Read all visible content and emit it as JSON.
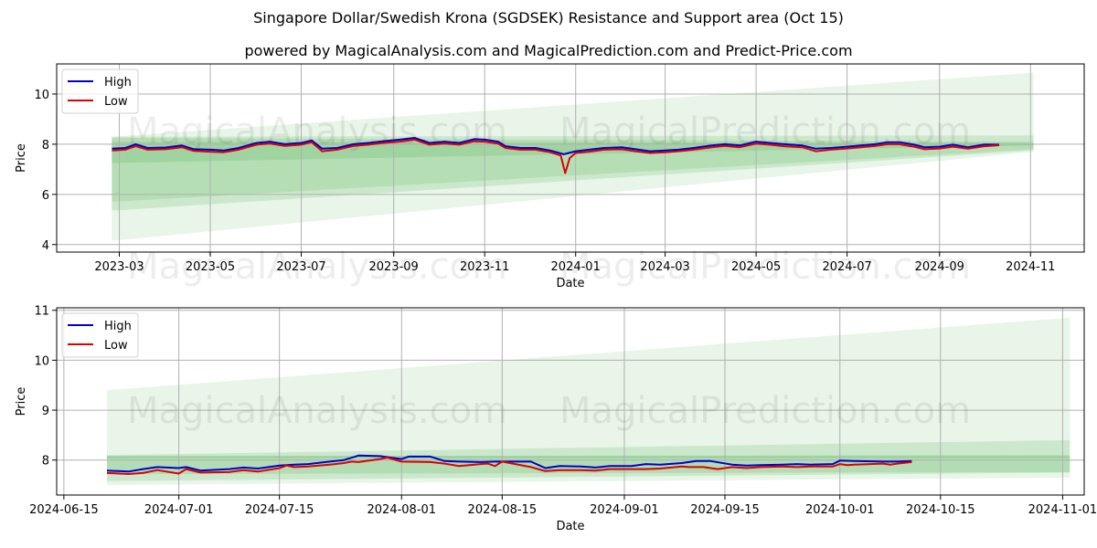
{
  "header": {
    "title": "Singapore Dollar/Swedish Krona (SGDSEK) Resistance and Support area (Oct 15)",
    "subtitle": "powered by MagicalAnalysis.com and MagicalPrediction.com and Predict-Price.com"
  },
  "watermarks": [
    "MagicalAnalysis.com",
    "MagicalPrediction.com"
  ],
  "colors": {
    "high": "#0000cc",
    "low": "#dd0000",
    "band": "#4caf50",
    "grid": "#b0b0b0"
  },
  "chart_data": [
    {
      "type": "line",
      "title": "",
      "xlabel": "Date",
      "ylabel": "Price",
      "grid": true,
      "legend": "top-left",
      "xlim": [
        "2023-01-18",
        "2024-12-07"
      ],
      "ylim": [
        3.7,
        11.2
      ],
      "x_ticks": [
        "2023-03",
        "2023-05",
        "2023-07",
        "2023-09",
        "2023-11",
        "2024-01",
        "2024-03",
        "2024-05",
        "2024-07",
        "2024-09",
        "2024-11"
      ],
      "x_tick_dates": [
        "2023-03-01",
        "2023-05-01",
        "2023-07-01",
        "2023-09-01",
        "2023-11-01",
        "2024-01-01",
        "2024-03-01",
        "2024-05-01",
        "2024-07-01",
        "2024-09-01",
        "2024-11-01"
      ],
      "y_ticks": [
        4,
        6,
        8,
        10
      ],
      "bands": [
        {
          "name": "wide-band",
          "x": [
            "2023-02-24",
            "2024-11-03"
          ],
          "upper": [
            8.3,
            10.85
          ],
          "lower": [
            4.15,
            7.7
          ],
          "opacity": 0.13
        },
        {
          "name": "mid-band",
          "x": [
            "2023-02-24",
            "2024-11-03"
          ],
          "upper": [
            8.3,
            8.35
          ],
          "lower": [
            5.35,
            7.75
          ],
          "opacity": 0.18
        },
        {
          "name": "inner-band",
          "x": [
            "2023-02-24",
            "2024-11-03"
          ],
          "upper": [
            8.25,
            8.1
          ],
          "lower": [
            5.7,
            7.8
          ],
          "opacity": 0.18
        },
        {
          "name": "core-band",
          "x": [
            "2023-02-24",
            "2024-11-03"
          ],
          "upper": [
            8.1,
            8.05
          ],
          "lower": [
            7.25,
            7.95
          ],
          "opacity": 0.2
        }
      ],
      "series": [
        {
          "name": "High",
          "x": [
            "2023-02-24",
            "2023-03-05",
            "2023-03-12",
            "2023-03-20",
            "2023-04-01",
            "2023-04-12",
            "2023-04-20",
            "2023-05-01",
            "2023-05-10",
            "2023-05-20",
            "2023-06-01",
            "2023-06-10",
            "2023-06-20",
            "2023-07-01",
            "2023-07-08",
            "2023-07-15",
            "2023-07-25",
            "2023-08-05",
            "2023-08-15",
            "2023-08-25",
            "2023-09-05",
            "2023-09-15",
            "2023-09-25",
            "2023-10-05",
            "2023-10-15",
            "2023-10-25",
            "2023-11-01",
            "2023-11-10",
            "2023-11-15",
            "2023-11-25",
            "2023-12-05",
            "2023-12-15",
            "2023-12-24",
            "2024-01-01",
            "2024-01-10",
            "2024-01-20",
            "2024-02-01",
            "2024-02-10",
            "2024-02-20",
            "2024-03-01",
            "2024-03-10",
            "2024-03-20",
            "2024-04-01",
            "2024-04-10",
            "2024-04-20",
            "2024-05-01",
            "2024-05-10",
            "2024-05-20",
            "2024-06-01",
            "2024-06-10",
            "2024-06-20",
            "2024-07-01",
            "2024-07-10",
            "2024-07-20",
            "2024-07-28",
            "2024-08-05",
            "2024-08-15",
            "2024-08-22",
            "2024-09-01",
            "2024-09-10",
            "2024-09-20",
            "2024-10-01",
            "2024-10-11"
          ],
          "values": [
            7.82,
            7.85,
            8.0,
            7.85,
            7.87,
            7.95,
            7.8,
            7.78,
            7.75,
            7.85,
            8.05,
            8.1,
            8.0,
            8.05,
            8.15,
            7.82,
            7.85,
            8.0,
            8.05,
            8.12,
            8.18,
            8.25,
            8.05,
            8.1,
            8.05,
            8.2,
            8.18,
            8.1,
            7.92,
            7.85,
            7.85,
            7.75,
            7.6,
            7.72,
            7.78,
            7.85,
            7.88,
            7.8,
            7.72,
            7.75,
            7.78,
            7.85,
            7.95,
            8.0,
            7.95,
            8.1,
            8.05,
            8.0,
            7.95,
            7.82,
            7.85,
            7.9,
            7.95,
            8.0,
            8.08,
            8.08,
            7.98,
            7.88,
            7.9,
            7.98,
            7.88,
            7.99,
            7.98
          ],
          "color": "#0000cc"
        },
        {
          "name": "Low",
          "x": [
            "2023-02-24",
            "2023-03-05",
            "2023-03-12",
            "2023-03-20",
            "2023-04-01",
            "2023-04-12",
            "2023-04-20",
            "2023-05-01",
            "2023-05-10",
            "2023-05-20",
            "2023-06-01",
            "2023-06-10",
            "2023-06-20",
            "2023-07-01",
            "2023-07-08",
            "2023-07-15",
            "2023-07-25",
            "2023-08-05",
            "2023-08-15",
            "2023-08-25",
            "2023-09-05",
            "2023-09-15",
            "2023-09-25",
            "2023-10-05",
            "2023-10-15",
            "2023-10-25",
            "2023-11-01",
            "2023-11-10",
            "2023-11-15",
            "2023-11-25",
            "2023-12-05",
            "2023-12-15",
            "2023-12-22",
            "2023-12-25",
            "2023-12-28",
            "2024-01-01",
            "2024-01-10",
            "2024-01-20",
            "2024-02-01",
            "2024-02-10",
            "2024-02-20",
            "2024-03-01",
            "2024-03-10",
            "2024-03-20",
            "2024-04-01",
            "2024-04-10",
            "2024-04-20",
            "2024-05-01",
            "2024-05-10",
            "2024-05-20",
            "2024-06-01",
            "2024-06-10",
            "2024-06-20",
            "2024-07-01",
            "2024-07-10",
            "2024-07-20",
            "2024-07-28",
            "2024-08-05",
            "2024-08-15",
            "2024-08-22",
            "2024-09-01",
            "2024-09-10",
            "2024-09-20",
            "2024-10-01",
            "2024-10-11"
          ],
          "values": [
            7.75,
            7.78,
            7.92,
            7.78,
            7.8,
            7.88,
            7.73,
            7.7,
            7.68,
            7.78,
            7.98,
            8.03,
            7.93,
            7.98,
            8.08,
            7.72,
            7.78,
            7.93,
            7.98,
            8.05,
            8.1,
            8.18,
            7.98,
            8.03,
            7.98,
            8.12,
            8.1,
            8.02,
            7.85,
            7.78,
            7.78,
            7.68,
            7.55,
            6.85,
            7.45,
            7.65,
            7.7,
            7.78,
            7.8,
            7.72,
            7.65,
            7.68,
            7.72,
            7.78,
            7.88,
            7.93,
            7.88,
            8.02,
            7.98,
            7.92,
            7.88,
            7.72,
            7.78,
            7.83,
            7.88,
            7.93,
            8.0,
            8.0,
            7.9,
            7.8,
            7.83,
            7.9,
            7.82,
            7.92,
            7.96
          ],
          "color": "#dd0000"
        }
      ]
    },
    {
      "type": "line",
      "title": "",
      "xlabel": "Date",
      "ylabel": "Price",
      "grid": true,
      "legend": "top-left",
      "xlim": [
        "2024-06-14",
        "2024-11-04"
      ],
      "ylim": [
        7.3,
        11.05
      ],
      "x_ticks": [
        "2024-06-15",
        "2024-07-01",
        "2024-07-15",
        "2024-08-01",
        "2024-08-15",
        "2024-09-01",
        "2024-09-15",
        "2024-10-01",
        "2024-10-15",
        "2024-11-01"
      ],
      "y_ticks": [
        8,
        9,
        10,
        11
      ],
      "bands": [
        {
          "name": "wide-band",
          "x": [
            "2024-06-21",
            "2024-11-02"
          ],
          "upper": [
            9.4,
            10.85
          ],
          "lower": [
            7.5,
            7.65
          ],
          "opacity": 0.13
        },
        {
          "name": "mid-band",
          "x": [
            "2024-06-21",
            "2024-11-02"
          ],
          "upper": [
            8.1,
            8.4
          ],
          "lower": [
            7.58,
            7.75
          ],
          "opacity": 0.18
        },
        {
          "name": "core-band",
          "x": [
            "2024-06-21",
            "2024-11-02"
          ],
          "upper": [
            8.08,
            8.1
          ],
          "lower": [
            7.72,
            7.76
          ],
          "opacity": 0.2
        },
        {
          "name": "resistance-line",
          "x": [
            "2024-06-21",
            "2024-11-02"
          ],
          "upper": [
            8.08,
            8.08
          ],
          "lower": [
            8.04,
            8.04
          ],
          "opacity": 0.25
        }
      ],
      "series": [
        {
          "name": "High",
          "x": [
            "2024-06-21",
            "2024-06-24",
            "2024-06-26",
            "2024-06-28",
            "2024-07-01",
            "2024-07-02",
            "2024-07-04",
            "2024-07-08",
            "2024-07-10",
            "2024-07-12",
            "2024-07-15",
            "2024-07-17",
            "2024-07-19",
            "2024-07-22",
            "2024-07-24",
            "2024-07-26",
            "2024-07-29",
            "2024-08-01",
            "2024-08-02",
            "2024-08-05",
            "2024-08-07",
            "2024-08-09",
            "2024-08-12",
            "2024-08-14",
            "2024-08-16",
            "2024-08-19",
            "2024-08-21",
            "2024-08-23",
            "2024-08-26",
            "2024-08-28",
            "2024-08-30",
            "2024-09-02",
            "2024-09-04",
            "2024-09-06",
            "2024-09-09",
            "2024-09-11",
            "2024-09-13",
            "2024-09-16",
            "2024-09-18",
            "2024-09-20",
            "2024-09-23",
            "2024-09-25",
            "2024-09-27",
            "2024-09-30",
            "2024-10-01",
            "2024-10-03",
            "2024-10-07",
            "2024-10-09",
            "2024-10-11"
          ],
          "values": [
            7.79,
            7.77,
            7.82,
            7.86,
            7.84,
            7.86,
            7.79,
            7.82,
            7.85,
            7.83,
            7.89,
            7.91,
            7.92,
            7.97,
            8.0,
            8.09,
            8.08,
            8.02,
            8.07,
            8.07,
            7.98,
            7.97,
            7.96,
            7.97,
            7.97,
            7.97,
            7.84,
            7.88,
            7.87,
            7.85,
            7.88,
            7.88,
            7.92,
            7.91,
            7.94,
            7.98,
            7.98,
            7.91,
            7.89,
            7.9,
            7.91,
            7.92,
            7.91,
            7.92,
            7.99,
            7.98,
            7.97,
            7.97,
            7.98
          ],
          "color": "#0000cc"
        },
        {
          "name": "Low",
          "x": [
            "2024-06-21",
            "2024-06-24",
            "2024-06-26",
            "2024-06-28",
            "2024-07-01",
            "2024-07-02",
            "2024-07-04",
            "2024-07-08",
            "2024-07-10",
            "2024-07-12",
            "2024-07-15",
            "2024-07-16",
            "2024-07-17",
            "2024-07-19",
            "2024-07-22",
            "2024-07-24",
            "2024-07-25",
            "2024-07-26",
            "2024-07-29",
            "2024-07-30",
            "2024-08-01",
            "2024-08-05",
            "2024-08-07",
            "2024-08-09",
            "2024-08-12",
            "2024-08-13",
            "2024-08-14",
            "2024-08-15",
            "2024-08-19",
            "2024-08-21",
            "2024-08-23",
            "2024-08-26",
            "2024-08-28",
            "2024-08-30",
            "2024-09-02",
            "2024-09-04",
            "2024-09-06",
            "2024-09-09",
            "2024-09-10",
            "2024-09-12",
            "2024-09-14",
            "2024-09-16",
            "2024-09-18",
            "2024-09-20",
            "2024-09-23",
            "2024-09-25",
            "2024-09-27",
            "2024-09-30",
            "2024-10-01",
            "2024-10-02",
            "2024-10-03",
            "2024-10-07",
            "2024-10-08",
            "2024-10-09",
            "2024-10-11"
          ],
          "values": [
            7.74,
            7.72,
            7.74,
            7.8,
            7.73,
            7.82,
            7.75,
            7.76,
            7.8,
            7.77,
            7.84,
            7.89,
            7.86,
            7.87,
            7.91,
            7.94,
            7.97,
            7.96,
            8.02,
            8.05,
            7.97,
            7.96,
            7.93,
            7.88,
            7.92,
            7.93,
            7.88,
            7.97,
            7.86,
            7.78,
            7.8,
            7.8,
            7.79,
            7.82,
            7.82,
            7.82,
            7.83,
            7.87,
            7.86,
            7.86,
            7.82,
            7.86,
            7.84,
            7.86,
            7.87,
            7.86,
            7.87,
            7.87,
            7.92,
            7.9,
            7.91,
            7.93,
            7.91,
            7.93,
            7.96
          ],
          "color": "#dd0000"
        }
      ]
    }
  ]
}
